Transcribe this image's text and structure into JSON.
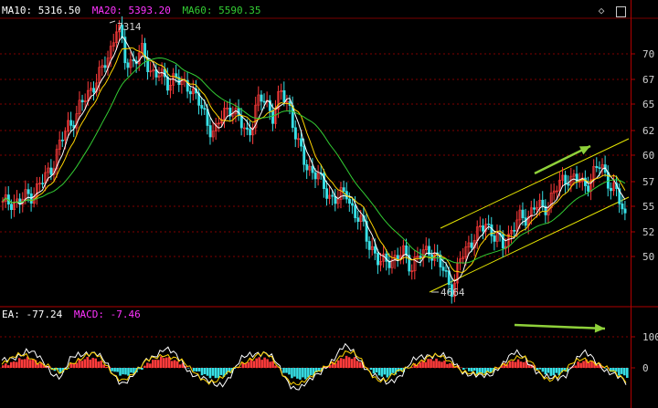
{
  "indicators_top": {
    "ma10": {
      "label": "MA10: 5316.50",
      "color": "#ffffff"
    },
    "ma20": {
      "label": "MA20: 5393.20",
      "color": "#ff33ff"
    },
    "ma60": {
      "label": "MA60: 5590.35",
      "color": "#33cc33"
    }
  },
  "indicators_bottom": {
    "dea": {
      "label": "EA: -77.24",
      "color": "#ffffff"
    },
    "macd": {
      "label": "MACD: -7.46",
      "color": "#ff33ff"
    }
  },
  "toolbar": {
    "diamond_icon": "◇",
    "restore_icon": "▢"
  },
  "annotations": {
    "high": "7314",
    "low": "4664"
  },
  "chart_data": [
    {
      "type": "candlestick",
      "y_ticks": [
        "70",
        "67",
        "65",
        "62",
        "60",
        "57",
        "55",
        "52",
        "50"
      ],
      "high_label": "7314",
      "low_label": "4664",
      "grid": true,
      "price_trend": [
        5500,
        5560,
        5520,
        5600,
        5650,
        5750,
        5900,
        6100,
        6300,
        6400,
        6550,
        6700,
        6800,
        7000,
        7314,
        6900,
        6950,
        7000,
        6850,
        6800,
        6700,
        6800,
        6650,
        6700,
        6500,
        6300,
        6250,
        6400,
        6500,
        6300,
        6200,
        6500,
        6550,
        6400,
        6600,
        6500,
        6100,
        5900,
        5850,
        5700,
        5600,
        5550,
        5650,
        5400,
        5300,
        5100,
        4900,
        5000,
        4950,
        5050,
        4900,
        5000,
        5100,
        4950,
        4850,
        4664,
        5000,
        5150,
        5200,
        5350,
        5200,
        5100,
        5250,
        5350,
        5400,
        5500,
        5450,
        5600,
        5700,
        5800,
        5750,
        5700,
        5800,
        5900,
        5750,
        5600,
        5400
      ]
    },
    {
      "type": "bar",
      "y_ticks": [
        "100",
        "0"
      ],
      "macd_hist": [
        10,
        20,
        35,
        40,
        25,
        10,
        -10,
        -20,
        15,
        30,
        40,
        35,
        10,
        -15,
        -30,
        -25,
        -10,
        20,
        35,
        45,
        30,
        15,
        -5,
        -20,
        -35,
        -40,
        -30,
        -10,
        15,
        30,
        40,
        35,
        10,
        -20,
        -40,
        -45,
        -35,
        -15,
        10,
        25,
        45,
        40,
        20,
        -10,
        -30,
        -35,
        -20,
        -10,
        10,
        25,
        35,
        30,
        20,
        10,
        -5,
        -15,
        -25,
        -20,
        5,
        20,
        30,
        25,
        10,
        -15,
        -30,
        -25,
        -10,
        15,
        30,
        25,
        10,
        -10,
        -25,
        -35
      ]
    }
  ]
}
